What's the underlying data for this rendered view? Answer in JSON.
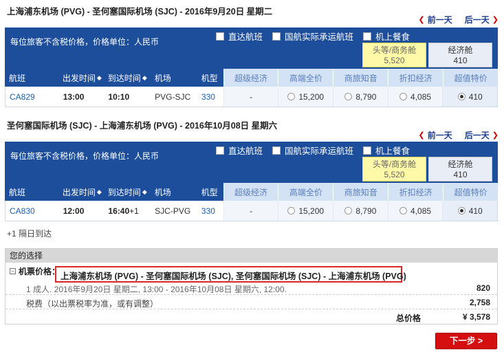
{
  "outbound": {
    "title": "上海浦东机场 (PVG) - 圣何塞国际机场 (SJC) - 2016年9月20日 星期二",
    "prev_day": "前一天",
    "next_day": "后一天",
    "price_note": "每位旅客不含税价格，价格单位：人民币",
    "filters": [
      "直达航班",
      "国航实际承运航班",
      "机上餐食"
    ],
    "cabin_first": {
      "label": "头等/商务舱",
      "price": "5,520"
    },
    "cabin_economy": {
      "label": "经济舱",
      "price": "410"
    },
    "columns": {
      "flight": "航班",
      "depart": "出发时间",
      "arrive": "到达时间",
      "airport": "机场",
      "type": "机型",
      "fares": [
        "超级经济",
        "高端全价",
        "商旅知音",
        "折扣经济",
        "超值特价"
      ]
    },
    "flight": {
      "no": "CA829",
      "depart": "13:00",
      "arrive": "10:10",
      "airport": "PVG-SJC",
      "type": "330",
      "fares": [
        "-",
        "15,200",
        "8,790",
        "4,085",
        "410"
      ]
    }
  },
  "return": {
    "title": "圣何塞国际机场 (SJC) - 上海浦东机场 (PVG) - 2016年10月08日 星期六",
    "prev_day": "前一天",
    "next_day": "后一天",
    "price_note": "每位旅客不含税价格，价格单位：人民币",
    "filters": [
      "直达航班",
      "国航实际承运航班",
      "机上餐食"
    ],
    "cabin_first": {
      "label": "头等/商务舱",
      "price": "5,520"
    },
    "cabin_economy": {
      "label": "经济舱",
      "price": "410"
    },
    "columns": {
      "flight": "航班",
      "depart": "出发时间",
      "arrive": "到达时间",
      "airport": "机场",
      "type": "机型",
      "fares": [
        "超级经济",
        "高端全价",
        "商旅知音",
        "折扣经济",
        "超值特价"
      ]
    },
    "flight": {
      "no": "CA830",
      "depart": "12:00",
      "arrive": "16:40",
      "arrive_suffix": "+1",
      "airport": "SJC-PVG",
      "type": "330",
      "fares": [
        "-",
        "15,200",
        "8,790",
        "4,085",
        "410"
      ]
    }
  },
  "next_day_note": "+1 隔日到达",
  "summary": {
    "heading": "您的选择",
    "ticket_label": "机票价格：",
    "ticket_route": "上海浦东机场 (PVG) - 圣何塞国际机场 (SJC), 圣何塞国际机场 (SJC) - 上海浦东机场 (PVG)",
    "pax_line": "1 成人. 2016年9月20日 星期二, 13:00 - 2016年10月08日 星期六, 12:00.",
    "pax_amount": "820",
    "tax_line": "税费（以出票税率为准，或有调整）",
    "tax_amount": "2,758",
    "total_label": "总价格",
    "total_amount": "¥ 3,578"
  },
  "next_button": "下一步 >",
  "colors": {
    "bar": "#1d4e9b",
    "fare_header": "#d3e2f4",
    "accent_red": "#d50f0f",
    "link_blue": "#1a5fb4"
  }
}
